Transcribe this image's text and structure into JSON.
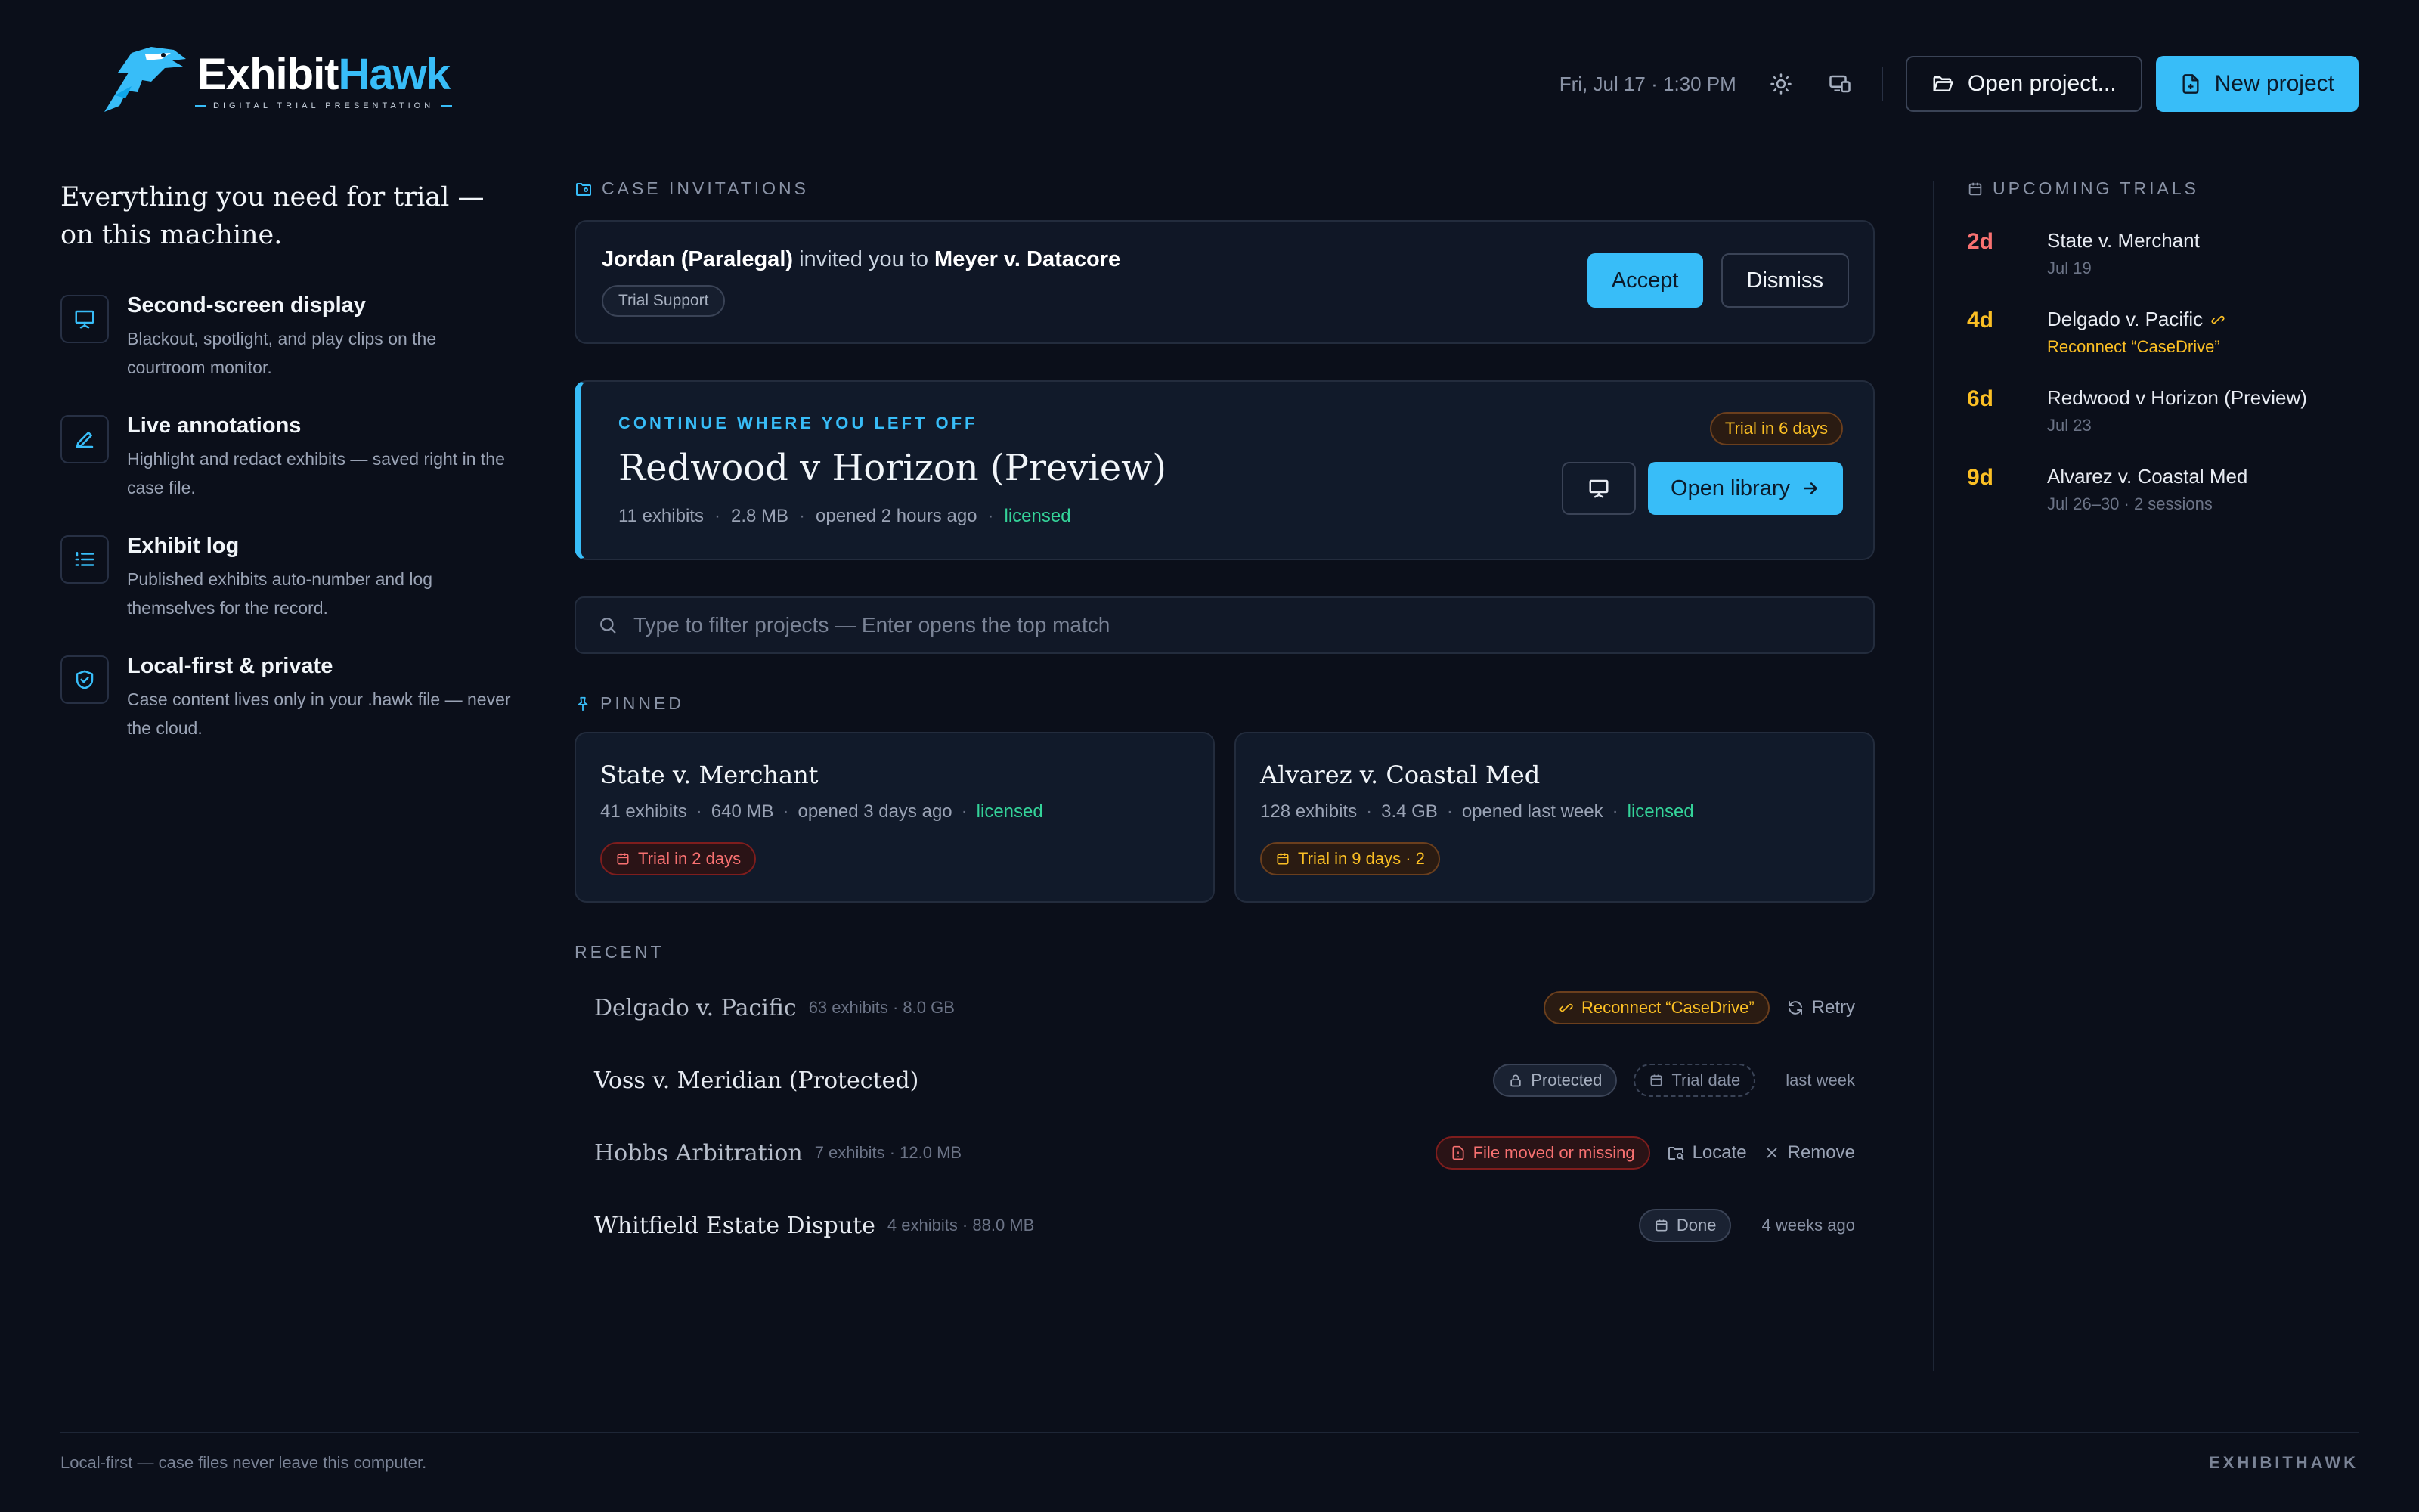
{
  "header": {
    "logo": {
      "word1": "Exhibit",
      "word2": "Hawk",
      "tagline": "DIGITAL TRIAL PRESENTATION"
    },
    "datetime": "Fri, Jul 17 · 1:30 PM",
    "icons": [
      "sun-icon",
      "monitor-devices-icon"
    ],
    "open_project_label": "Open project...",
    "new_project_label": "New project"
  },
  "sidebar": {
    "tagline": "Everything you need for trial — on this machine.",
    "features": [
      {
        "icon": "presentation-screen-icon",
        "title": "Second-screen display",
        "desc": "Blackout, spotlight, and play clips on the courtroom monitor."
      },
      {
        "icon": "pen-annotate-icon",
        "title": "Live annotations",
        "desc": "Highlight and redact exhibits — saved right in the case file."
      },
      {
        "icon": "list-numbered-icon",
        "title": "Exhibit log",
        "desc": "Published exhibits auto-number and log themselves for the record."
      },
      {
        "icon": "shield-check-icon",
        "title": "Local-first & private",
        "desc": "Case content lives only in your .hawk file — never the cloud."
      }
    ]
  },
  "invitations": {
    "label": "CASE INVITATIONS",
    "from": "Jordan (Paralegal)",
    "middle": " invited you to ",
    "case": "Meyer v. Datacore",
    "role": "Trial Support",
    "accept_label": "Accept",
    "dismiss_label": "Dismiss"
  },
  "continue": {
    "label": "CONTINUE WHERE YOU LEFT OFF",
    "title": "Redwood v Horizon (Preview)",
    "exhibits": "11 exhibits",
    "size": "2.8 MB",
    "opened": "opened 2 hours ago",
    "license": "licensed",
    "badge": "Trial in 6 days",
    "open_label": "Open library"
  },
  "search": {
    "placeholder": "Type to filter projects — Enter opens the top match"
  },
  "pinned": {
    "label": "PINNED",
    "cards": [
      {
        "title": "State v. Merchant",
        "exhibits": "41 exhibits",
        "size": "640 MB",
        "opened": "opened 3 days ago",
        "license": "licensed",
        "badge": "Trial in 2 days",
        "badge_color": "#f87171"
      },
      {
        "title": "Alvarez v. Coastal Med",
        "exhibits": "128 exhibits",
        "size": "3.4 GB",
        "opened": "opened last week",
        "license": "licensed",
        "badge": "Trial in 9 days · 2",
        "badge_color": "#fbbf24"
      }
    ]
  },
  "recent": {
    "label": "RECENT",
    "rows": [
      {
        "name": "Delgado v. Pacific",
        "meta": "63 exhibits · 8.0 GB",
        "chip": "Reconnect “CaseDrive”",
        "action": "Retry"
      },
      {
        "name": "Voss v. Meridian (Protected)",
        "chip1": "Protected",
        "chip2": "Trial date",
        "time": "last week"
      },
      {
        "name": "Hobbs Arbitration",
        "meta": "7 exhibits · 12.0 MB",
        "chip": "File moved or missing",
        "action1": "Locate",
        "action2": "Remove"
      },
      {
        "name": "Whitfield Estate Dispute",
        "meta": "4 exhibits · 88.0 MB",
        "chip": "Done",
        "time": "4 weeks ago"
      }
    ]
  },
  "upcoming": {
    "label": "UPCOMING TRIALS",
    "items": [
      {
        "days": "2d",
        "name": "State v. Merchant",
        "sub": "Jul 19",
        "color": "#f87171"
      },
      {
        "days": "4d",
        "name": "Delgado v. Pacific",
        "sub": "Reconnect “CaseDrive”",
        "color": "#fbbf24"
      },
      {
        "days": "6d",
        "name": "Redwood v Horizon (Preview)",
        "sub": "Jul 23",
        "color": "#fbbf24"
      },
      {
        "days": "9d",
        "name": "Alvarez v. Coastal Med",
        "sub": "Jul 26–30 · 2 sessions",
        "color": "#fbbf24"
      }
    ]
  },
  "footer": {
    "left": "Local-first — case files never leave this computer.",
    "right": "EXHIBITHAWK"
  },
  "colors": {
    "accent": "#38bdf8",
    "background": "#0b0f1a",
    "success": "#34d399",
    "warning": "#fbbf24",
    "danger": "#f87171"
  }
}
